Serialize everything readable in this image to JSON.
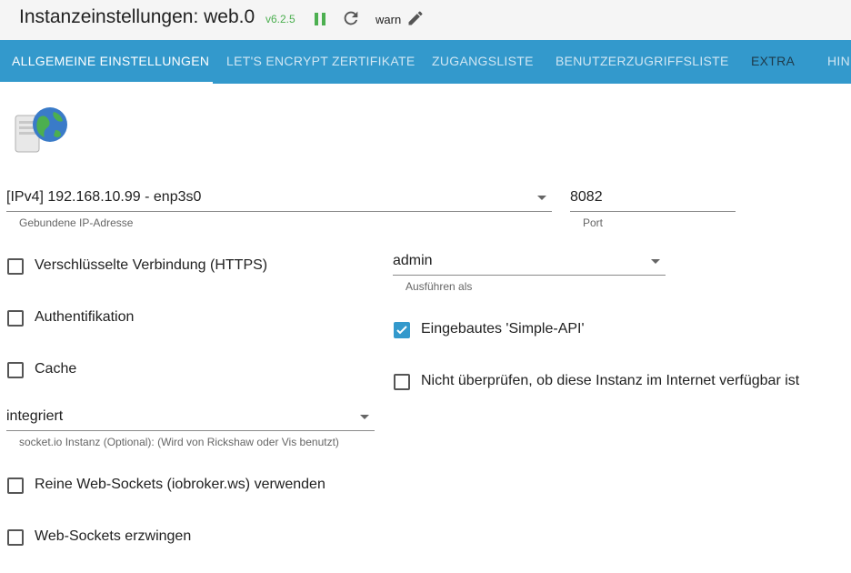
{
  "header": {
    "title": "Instanzeinstellungen: web.0",
    "version": "v6.2.5",
    "log_level": "warn",
    "icons": [
      "pause-icon",
      "reload-icon",
      "edit-icon"
    ],
    "version_color": "#4caf50"
  },
  "tabs": [
    {
      "label": "ALLGEMEINE EINSTELLUNGEN",
      "active": true
    },
    {
      "label": "LET'S ENCRYPT ZERTIFIKATE",
      "active": false
    },
    {
      "label": "ZUGANGSLISTE",
      "active": false
    },
    {
      "label": "BENUTZERZUGRIFFSLISTE",
      "active": false
    },
    {
      "label": "EXTRA",
      "active": false
    },
    {
      "label": "HIN",
      "active": false
    }
  ],
  "accent_color": "#3399cc",
  "bind": {
    "value": "[IPv4] 192.168.10.99 - enp3s0",
    "label": "Gebundene IP-Adresse"
  },
  "port": {
    "value": "8082",
    "label": "Port"
  },
  "run_as": {
    "value": "admin",
    "label": "Ausführen als"
  },
  "socketio": {
    "value": "integriert",
    "label": "socket.io Instanz (Optional): (Wird von Rickshaw oder Vis benutzt)"
  },
  "checkboxes": {
    "https": {
      "label": "Verschlüsselte Verbindung (HTTPS)",
      "checked": false
    },
    "auth": {
      "label": "Authentifikation",
      "checked": false
    },
    "cache": {
      "label": "Cache",
      "checked": false
    },
    "simple_api": {
      "label": "Eingebautes 'Simple-API'",
      "checked": true
    },
    "no_check": {
      "label": "Nicht überprüfen, ob diese Instanz im Internet verfügbar ist",
      "checked": false
    },
    "pure_ws": {
      "label": "Reine Web-Sockets (iobroker.ws) verwenden",
      "checked": false
    },
    "force_ws": {
      "label": "Web-Sockets erzwingen",
      "checked": false
    }
  }
}
